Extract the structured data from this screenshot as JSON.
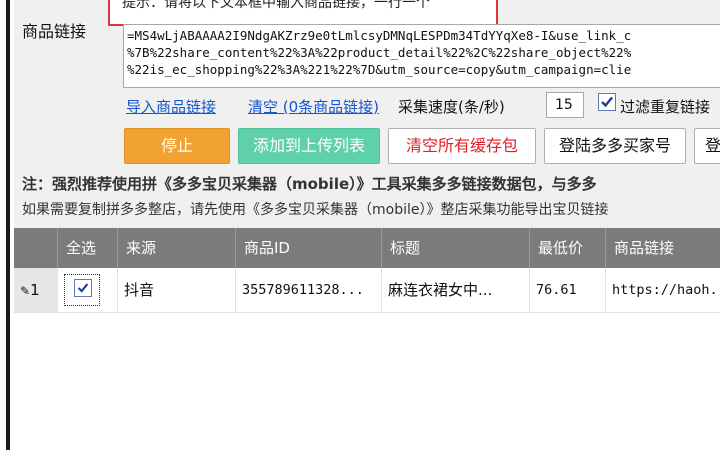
{
  "hint": "提示：请将以下文本框中输入商品链接，一行一个",
  "form": {
    "link_label": "商品链接",
    "link_text": "=MS4wLjABAAAA2I9NdgAKZrz9e0tLmlcsyDMNqLESPDm34TdYYqXe8-I&use_link_c\n%7B%22share_content%22%3A%22product_detail%22%2C%22share_object%22%\n%22is_ec_shopping%22%3A%221%22%7D&utm_source=copy&utm_campaign=clie",
    "import_link": "导入商品链接",
    "clear_link": "清空 (0条商品链接)",
    "speed_label": "采集速度(条/秒)",
    "speed_value": "15",
    "filter_label": "过滤重复链接",
    "filter_checked": true
  },
  "buttons": {
    "stop": "停止",
    "add_to_upload": "添加到上传列表",
    "clear_cache": "清空所有缓存包",
    "login_buyer": "登陆多多买家号",
    "more": "登"
  },
  "notes": {
    "note1": "注：强烈推荐使用拼《多多宝贝采集器（mobile）》工具采集多多链接数据包，与多多",
    "note2": "如果需要复制拼多多整店，请先使用《多多宝贝采集器（mobile）》整店采集功能导出宝贝链接"
  },
  "table": {
    "columns": [
      "",
      "全选",
      "来源",
      "商品ID",
      "标题",
      "最低价",
      "商品链接"
    ],
    "rows": [
      {
        "index": "1",
        "checked": true,
        "source": "抖音",
        "product_id": "355789611328...",
        "title": "麻连衣裙女中...",
        "min_price": "76.61",
        "link": "https://haoh..."
      }
    ]
  },
  "colors": {
    "stop_button": "#f0a232",
    "add_button": "#5fd0ac",
    "clear_cache_text": "#e0202a",
    "link_color": "#1456d0",
    "table_header": "#7b7b7b",
    "hint_border": "#d9363e"
  }
}
